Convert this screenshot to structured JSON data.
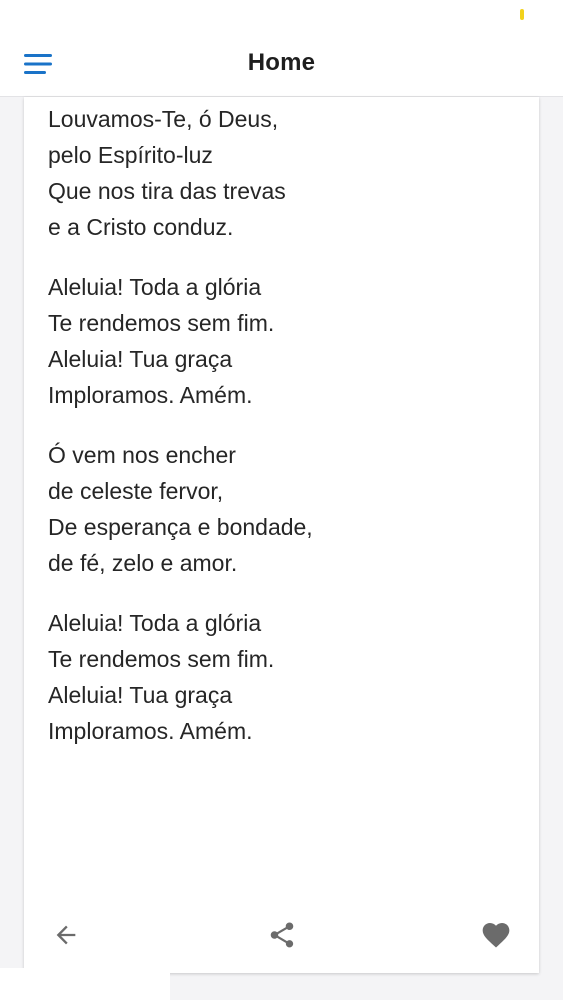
{
  "app_bar": {
    "title": "Home",
    "menu_icon": "hamburger-menu-icon"
  },
  "colors": {
    "accent": "#1a73c8",
    "text": "#262626",
    "icon": "#6b6b6b",
    "status_dot": "#f2d21b"
  },
  "lyrics": [
    [
      "Louvamos-Te, ó Deus,",
      "pelo Espírito-luz",
      "Que nos tira das trevas",
      "e a Cristo conduz."
    ],
    [
      "Aleluia! Toda a glória",
      "Te rendemos sem fim.",
      "Aleluia! Tua graça",
      "Imploramos. Amém."
    ],
    [
      "Ó vem nos encher",
      "de celeste fervor,",
      "De esperança e bondade,",
      "de fé, zelo e amor."
    ],
    [
      "Aleluia! Toda a glória",
      "Te rendemos sem fim.",
      "Aleluia! Tua graça",
      "Imploramos. Amém."
    ]
  ],
  "actions": {
    "back_icon": "arrow-left-icon",
    "share_icon": "share-icon",
    "favorite_icon": "heart-icon"
  }
}
